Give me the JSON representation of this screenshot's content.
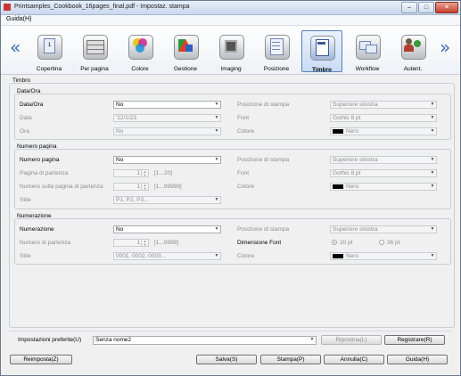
{
  "window": {
    "title": "Printsamples_Cookbook_16pages_final.pdf - Impostaz. stampa",
    "controls": [
      "–",
      "□",
      "✕"
    ]
  },
  "menu": {
    "help": "Guida(H)"
  },
  "toolbar": {
    "prev": "«",
    "next": "»",
    "tabs": [
      {
        "label": "Copertina",
        "icon": "cover-icon"
      },
      {
        "label": "Per pagina",
        "icon": "stack-icon"
      },
      {
        "label": "Colore",
        "icon": "color-icon"
      },
      {
        "label": "Gestione",
        "icon": "management-icon"
      },
      {
        "label": "Imaging",
        "icon": "imaging-icon"
      },
      {
        "label": "Posizione",
        "icon": "position-icon"
      },
      {
        "label": "Timbro",
        "icon": "stamp-icon",
        "active": true
      },
      {
        "label": "Workflow",
        "icon": "workflow-icon"
      },
      {
        "label": "Autent.",
        "icon": "auth-icon"
      }
    ]
  },
  "main": {
    "title": "Timbro",
    "date": {
      "group": "Data/Ora",
      "field_label": "Data/Ora",
      "field_value": "No",
      "data_label": "Data",
      "data_value": "'12/1/23",
      "ora_label": "Ora",
      "ora_value": "No",
      "pos_label": "Posizione di stampa",
      "pos_value": "Superiore sinistra",
      "font_label": "Font",
      "font_value": "Gothic 8 pt",
      "color_label": "Colore",
      "color_value": "Nero"
    },
    "page": {
      "group": "Numero pagina",
      "field_label": "Numero pagina",
      "field_value": "No",
      "start_label": "Pagina di partenza",
      "start_value": "1",
      "start_range": "[1...20]",
      "num_label": "Numero sulla pagina di partenza",
      "num_value": "1",
      "num_range": "[1...99999]",
      "style_label": "Stile",
      "style_value": "P1, P2, P3...",
      "pos_label": "Posizione di stampa",
      "pos_value": "Superiore sinistra",
      "font_label": "Font",
      "font_value": "Gothic 8 pt",
      "color_label": "Colore",
      "color_value": "Nero"
    },
    "numbering": {
      "group": "Numerazione",
      "field_label": "Numerazione",
      "field_value": "No",
      "start_label": "Numero di partenza",
      "start_value": "1",
      "start_range": "[1...9999]",
      "style_label": "Stile",
      "style_value": "0001, 0002, 0003...",
      "pos_label": "Posizione di stampa",
      "pos_value": "Superiore sinistra",
      "size_label": "Dimensione Font",
      "size_opt1": "20 pt",
      "size_opt2": "36 pt",
      "color_label": "Colore",
      "color_value": "Nero"
    }
  },
  "bottom": {
    "fav_label": "Impostazioni preferite(U)",
    "fav_value": "Senza nome2",
    "restore": "Ripristina(L)",
    "register": "Registrare(R)",
    "reset": "Reimposta(Z)",
    "save": "Salva(S)",
    "print": "Stampa(P)",
    "cancel": "Annulla(C)",
    "help": "Guida(H)"
  },
  "colors": {
    "accent": "#3a6cb0",
    "active_tab_border": "#5a7fb5",
    "swatch": "#000000"
  }
}
